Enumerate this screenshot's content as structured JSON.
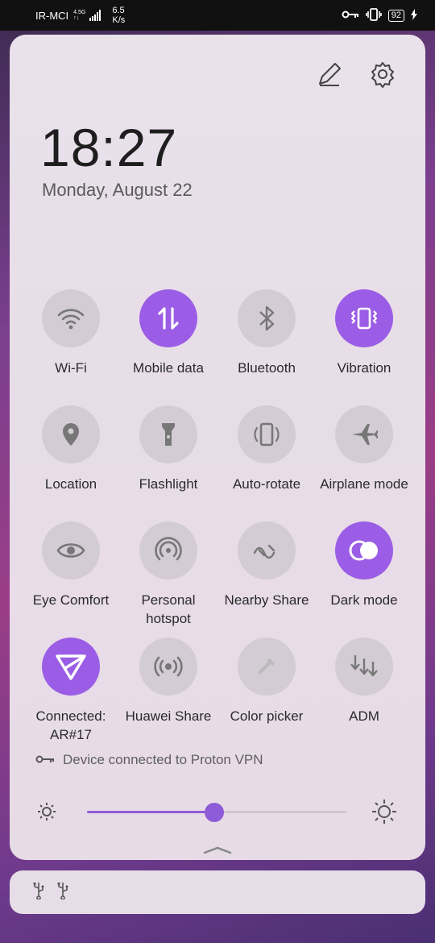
{
  "status_bar": {
    "carrier": "IR-MCI",
    "network_top": "4.5G",
    "network_bottom": "↑↓",
    "speed_value": "6.5",
    "speed_unit": "K/s",
    "battery": "92"
  },
  "panel": {
    "time": "18:27",
    "date": "Monday, August 22",
    "vpn_text": "Device connected to Proton VPN",
    "brightness_level": 0.49
  },
  "tiles": [
    {
      "label": "Wi-Fi",
      "icon": "wifi-icon",
      "active": false
    },
    {
      "label": "Mobile data",
      "icon": "mobile-data-icon",
      "active": true
    },
    {
      "label": "Bluetooth",
      "icon": "bluetooth-icon",
      "active": false
    },
    {
      "label": "Vibration",
      "icon": "vibration-icon",
      "active": true
    },
    {
      "label": "Location",
      "icon": "location-icon",
      "active": false
    },
    {
      "label": "Flashlight",
      "icon": "flashlight-icon",
      "active": false
    },
    {
      "label": "Auto-rotate",
      "icon": "auto-rotate-icon",
      "active": false
    },
    {
      "label": "Airplane mode",
      "icon": "airplane-icon",
      "active": false
    },
    {
      "label": "Eye Comfort",
      "icon": "eye-icon",
      "active": false
    },
    {
      "label": "Personal hotspot",
      "icon": "hotspot-icon",
      "active": false
    },
    {
      "label": "Nearby Share",
      "icon": "nearby-share-icon",
      "active": false
    },
    {
      "label": "Dark mode",
      "icon": "dark-mode-icon",
      "active": true
    },
    {
      "label": "Connected: AR#17",
      "icon": "vpn-connected-icon",
      "active": true
    },
    {
      "label": "Huawei Share",
      "icon": "huawei-share-icon",
      "active": false
    },
    {
      "label": "Color picker",
      "icon": "color-picker-icon",
      "active": false
    },
    {
      "label": "ADM",
      "icon": "adm-icon",
      "active": false
    }
  ],
  "colors": {
    "accent": "#9b5de5",
    "inactive_tile": "#d3ccd5"
  }
}
